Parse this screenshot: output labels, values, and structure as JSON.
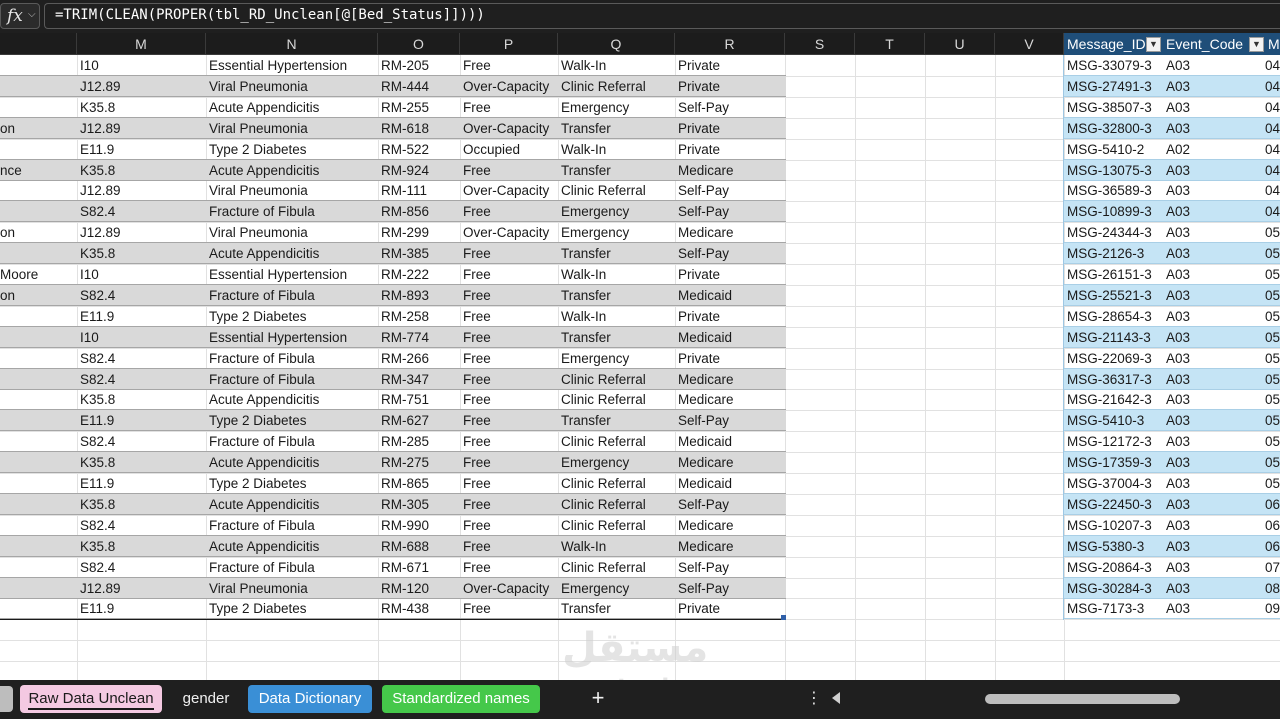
{
  "formula_bar": {
    "fx_label": "fx",
    "formula": "=TRIM(CLEAN(PROPER(tbl_RD_Unclean[@[Bed_Status]])))"
  },
  "columns": [
    "M",
    "N",
    "O",
    "P",
    "Q",
    "R",
    "S",
    "T",
    "U",
    "V"
  ],
  "right_table": {
    "headers": [
      "Message_ID",
      "Event_Code",
      "Me"
    ],
    "rows": [
      [
        "MSG-33079-3",
        "A03",
        "04"
      ],
      [
        "MSG-27491-3",
        "A03",
        "04"
      ],
      [
        "MSG-38507-3",
        "A03",
        "04"
      ],
      [
        "MSG-32800-3",
        "A03",
        "04"
      ],
      [
        "MSG-5410-2",
        "A02",
        "04"
      ],
      [
        "MSG-13075-3",
        "A03",
        "04"
      ],
      [
        "MSG-36589-3",
        "A03",
        "04"
      ],
      [
        "MSG-10899-3",
        "A03",
        "04"
      ],
      [
        "MSG-24344-3",
        "A03",
        "05"
      ],
      [
        "MSG-2126-3",
        "A03",
        "05"
      ],
      [
        "MSG-26151-3",
        "A03",
        "05"
      ],
      [
        "MSG-25521-3",
        "A03",
        "05"
      ],
      [
        "MSG-28654-3",
        "A03",
        "05"
      ],
      [
        "MSG-21143-3",
        "A03",
        "05"
      ],
      [
        "MSG-22069-3",
        "A03",
        "05"
      ],
      [
        "MSG-36317-3",
        "A03",
        "05"
      ],
      [
        "MSG-21642-3",
        "A03",
        "05"
      ],
      [
        "MSG-5410-3",
        "A03",
        "05"
      ],
      [
        "MSG-12172-3",
        "A03",
        "05"
      ],
      [
        "MSG-17359-3",
        "A03",
        "05"
      ],
      [
        "MSG-37004-3",
        "A03",
        "05"
      ],
      [
        "MSG-22450-3",
        "A03",
        "06"
      ],
      [
        "MSG-10207-3",
        "A03",
        "06"
      ],
      [
        "MSG-5380-3",
        "A03",
        "06"
      ],
      [
        "MSG-20864-3",
        "A03",
        "07"
      ],
      [
        "MSG-30284-3",
        "A03",
        "08"
      ],
      [
        "MSG-7173-3",
        "A03",
        "09"
      ]
    ]
  },
  "rows": [
    [
      "",
      "I10",
      "Essential Hypertension",
      "RM-205",
      "Free",
      "Walk-In",
      "Private"
    ],
    [
      "",
      "J12.89",
      "Viral Pneumonia",
      "RM-444",
      "Over-Capacity",
      "Clinic Referral",
      "Private"
    ],
    [
      "",
      "K35.8",
      "Acute Appendicitis",
      "RM-255",
      "Free",
      "Emergency",
      "Self-Pay"
    ],
    [
      "on",
      "J12.89",
      "Viral Pneumonia",
      "RM-618",
      "Over-Capacity",
      "Transfer",
      "Private"
    ],
    [
      "",
      "E11.9",
      "Type 2 Diabetes",
      "RM-522",
      "Occupied",
      "Walk-In",
      "Private"
    ],
    [
      "nce",
      "K35.8",
      "Acute Appendicitis",
      "RM-924",
      "Free",
      "Transfer",
      "Medicare"
    ],
    [
      "",
      "J12.89",
      "Viral Pneumonia",
      "RM-111",
      "Over-Capacity",
      "Clinic Referral",
      "Self-Pay"
    ],
    [
      "",
      "S82.4",
      "Fracture of Fibula",
      "RM-856",
      "Free",
      "Emergency",
      "Self-Pay"
    ],
    [
      "on",
      "J12.89",
      "Viral Pneumonia",
      "RM-299",
      "Over-Capacity",
      "Emergency",
      "Medicare"
    ],
    [
      "",
      "K35.8",
      "Acute Appendicitis",
      "RM-385",
      "Free",
      "Transfer",
      "Self-Pay"
    ],
    [
      "Moore",
      "I10",
      "Essential Hypertension",
      "RM-222",
      "Free",
      "Walk-In",
      "Private"
    ],
    [
      "on",
      "S82.4",
      "Fracture of Fibula",
      "RM-893",
      "Free",
      "Transfer",
      "Medicaid"
    ],
    [
      "",
      "E11.9",
      "Type 2 Diabetes",
      "RM-258",
      "Free",
      "Walk-In",
      "Private"
    ],
    [
      "",
      "I10",
      "Essential Hypertension",
      "RM-774",
      "Free",
      "Transfer",
      "Medicaid"
    ],
    [
      "",
      "S82.4",
      "Fracture of Fibula",
      "RM-266",
      "Free",
      "Emergency",
      "Private"
    ],
    [
      "",
      "S82.4",
      "Fracture of Fibula",
      "RM-347",
      "Free",
      "Clinic Referral",
      "Medicare"
    ],
    [
      "",
      "K35.8",
      "Acute Appendicitis",
      "RM-751",
      "Free",
      "Clinic Referral",
      "Medicare"
    ],
    [
      "",
      "E11.9",
      "Type 2 Diabetes",
      "RM-627",
      "Free",
      "Transfer",
      "Self-Pay"
    ],
    [
      "",
      "S82.4",
      "Fracture of Fibula",
      "RM-285",
      "Free",
      "Clinic Referral",
      "Medicaid"
    ],
    [
      "",
      "K35.8",
      "Acute Appendicitis",
      "RM-275",
      "Free",
      "Emergency",
      "Medicare"
    ],
    [
      "",
      "E11.9",
      "Type 2 Diabetes",
      "RM-865",
      "Free",
      "Clinic Referral",
      "Medicaid"
    ],
    [
      "",
      "K35.8",
      "Acute Appendicitis",
      "RM-305",
      "Free",
      "Clinic Referral",
      "Self-Pay"
    ],
    [
      "",
      "S82.4",
      "Fracture of Fibula",
      "RM-990",
      "Free",
      "Clinic Referral",
      "Medicare"
    ],
    [
      "",
      "K35.8",
      "Acute Appendicitis",
      "RM-688",
      "Free",
      "Walk-In",
      "Medicare"
    ],
    [
      "",
      "S82.4",
      "Fracture of Fibula",
      "RM-671",
      "Free",
      "Clinic Referral",
      "Self-Pay"
    ],
    [
      "",
      "J12.89",
      "Viral Pneumonia",
      "RM-120",
      "Over-Capacity",
      "Emergency",
      "Self-Pay"
    ],
    [
      "",
      "E11.9",
      "Type 2 Diabetes",
      "RM-438",
      "Free",
      "Transfer",
      "Private"
    ]
  ],
  "sheet_tabs": [
    {
      "label": "Raw Data Unclean",
      "style": "active"
    },
    {
      "label": "gender",
      "style": "plain"
    },
    {
      "label": "Data Dictionary",
      "style": "blue"
    },
    {
      "label": "Standardized names",
      "style": "green"
    }
  ],
  "add_sheet_label": "+",
  "more_label": "⋮",
  "watermark": {
    "arabic": "مستقل",
    "latin": "mostaql.com"
  },
  "colors": {
    "shaded_row": "#d9d9d9",
    "right_table_header": "#1f4e79",
    "right_table_row": "#c5e4f5",
    "active_tab": "#f4c9e2",
    "blue_tab": "#3a8fd6",
    "green_tab": "#45c84a"
  }
}
